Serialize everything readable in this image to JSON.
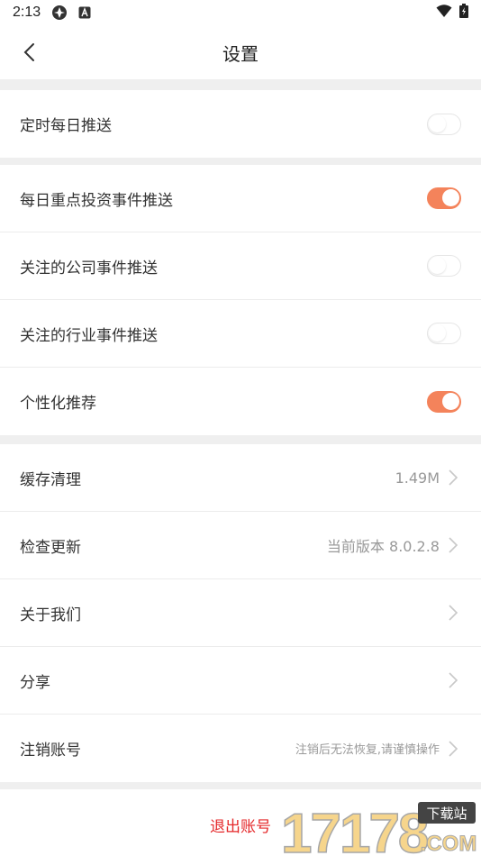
{
  "status_bar": {
    "time": "2:13"
  },
  "header": {
    "title": "设置"
  },
  "push_group_1": [
    {
      "label": "定时每日推送",
      "enabled": false
    }
  ],
  "push_group_2": [
    {
      "label": "每日重点投资事件推送",
      "enabled": true
    },
    {
      "label": "关注的公司事件推送",
      "enabled": false
    },
    {
      "label": "关注的行业事件推送",
      "enabled": false
    },
    {
      "label": "个性化推荐",
      "enabled": true
    }
  ],
  "general_group": [
    {
      "label": "缓存清理",
      "value": "1.49M"
    },
    {
      "label": "检查更新",
      "value": "当前版本 8.0.2.8"
    },
    {
      "label": "关于我们",
      "value": ""
    },
    {
      "label": "分享",
      "value": ""
    },
    {
      "label": "注销账号",
      "value": "注销后无法恢复,请谨慎操作"
    }
  ],
  "logout": {
    "label": "退出账号"
  },
  "watermark": {
    "number": "17178",
    "tag": "下载站",
    "domain": ".COM"
  },
  "colors": {
    "accent": "#f4835b",
    "danger": "#e5292b",
    "page_bg": "#efefef"
  }
}
